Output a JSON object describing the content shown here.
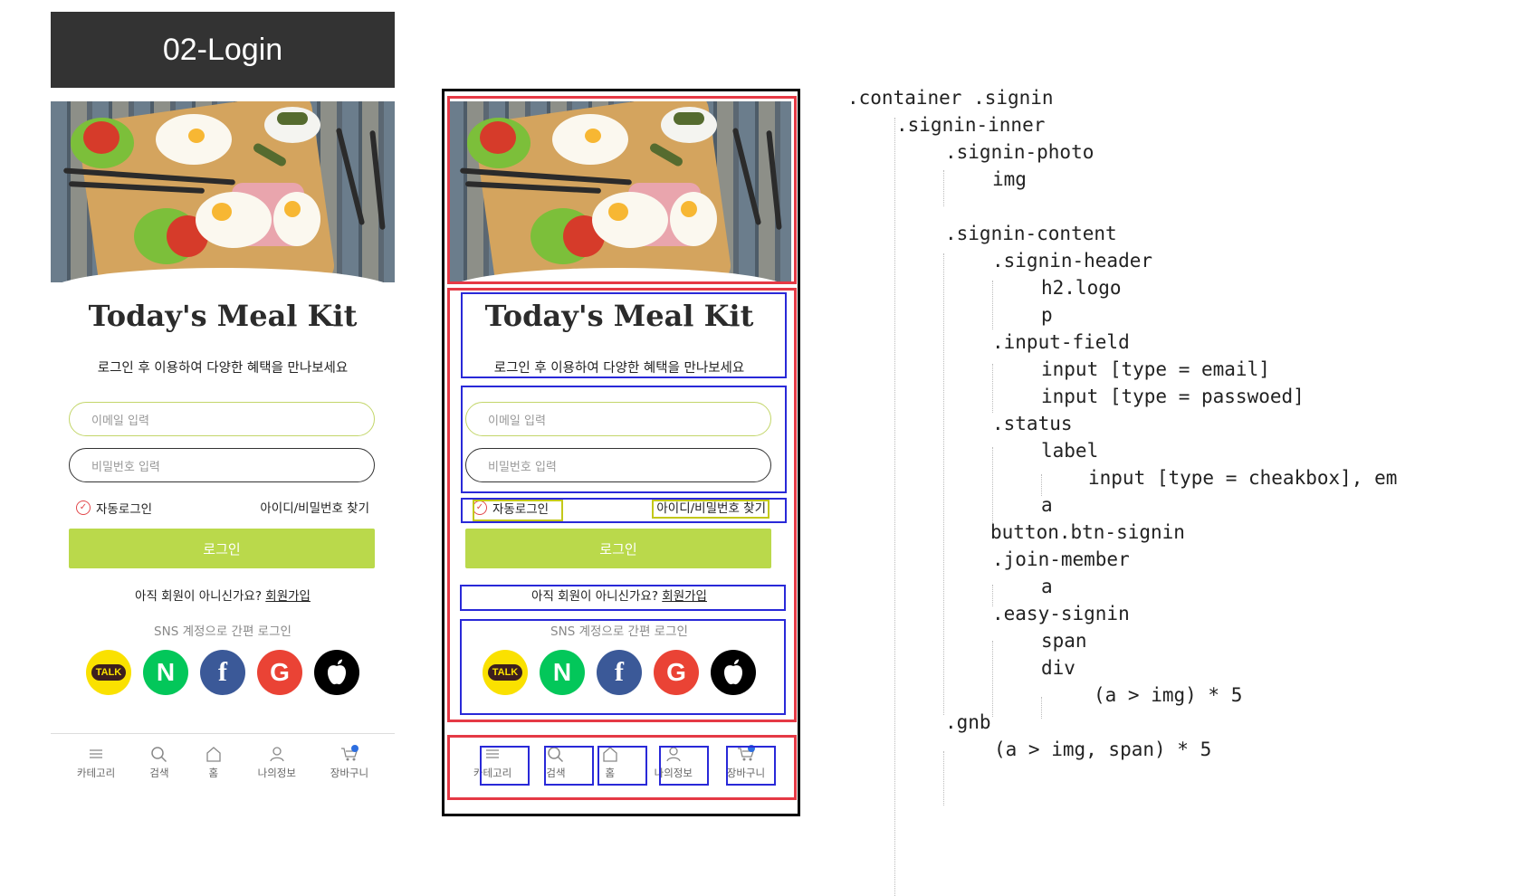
{
  "banner": {
    "title": "02-Login"
  },
  "login": {
    "logo": "Today's Meal Kit",
    "subtitle": "로그인 후 이용하여 다양한 혜택을 만나보세요",
    "email_placeholder": "이메일 입력",
    "password_placeholder": "비밀번호 입력",
    "auto_login": "자동로그인",
    "find_account": "아이디/비밀번호 찾기",
    "login_button": "로그인",
    "join_prompt": "아직 회원이 아니신가요?",
    "join_link": "회원가입",
    "sns_label": "SNS 계정으로 간편 로그인",
    "social": [
      {
        "name": "kakao",
        "label": "TALK",
        "icon": "kakao-icon",
        "color": "#fae100"
      },
      {
        "name": "naver",
        "label": "N",
        "icon": "naver-icon",
        "color": "#03c75a"
      },
      {
        "name": "facebook",
        "label": "f",
        "icon": "facebook-icon",
        "color": "#3b5998"
      },
      {
        "name": "google",
        "label": "G",
        "icon": "google-icon",
        "color": "#ea4335"
      },
      {
        "name": "apple",
        "label": "",
        "icon": "apple-icon",
        "color": "#000000"
      }
    ],
    "accent_color": "#bad94b"
  },
  "gnb": {
    "items": [
      {
        "label": "카테고리",
        "icon": "menu-icon"
      },
      {
        "label": "검색",
        "icon": "search-icon"
      },
      {
        "label": "홈",
        "icon": "home-icon"
      },
      {
        "label": "나의정보",
        "icon": "user-icon"
      },
      {
        "label": "장바구니",
        "icon": "cart-icon",
        "badge": "0"
      }
    ]
  },
  "annotation_colors": {
    "section": "#e53945",
    "block": "#2929d8",
    "inline": "#c3c81a"
  },
  "code_outline": [
    ".container .signin",
    ".signin-inner",
    ".signin-photo",
    "img",
    ".signin-content",
    ".signin-header",
    "h2.logo",
    "p",
    ".input-field",
    "input [type = email]",
    "input [type = passwoed]",
    ".status",
    "label",
    "input [type = cheakbox], em",
    "a",
    "button.btn-signin",
    ".join-member",
    "a",
    ".easy-signin",
    "span",
    "div",
    "(a > img) * 5",
    ".gnb",
    "(a > img, span) * 5"
  ]
}
